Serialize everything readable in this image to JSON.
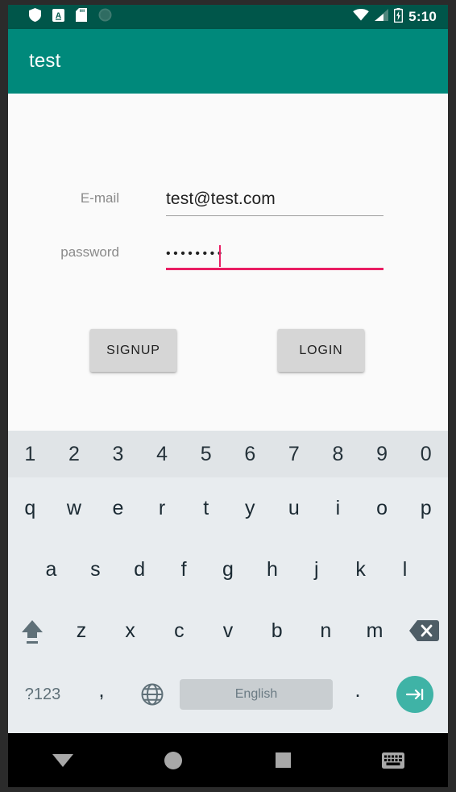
{
  "status_bar": {
    "icons": [
      "shield-icon",
      "a-badge-icon",
      "sd-card-icon",
      "sync-circle-icon"
    ],
    "wifi": "wifi-icon",
    "signal": "signal-icon",
    "battery": "battery-charging-icon",
    "clock": "5:10"
  },
  "app_bar": {
    "title": "test",
    "color": "#00897b"
  },
  "form": {
    "email": {
      "label": "E-mail",
      "value": "test@test.com",
      "underline_color": "#9e9e9e",
      "focused": false
    },
    "password": {
      "label": "password",
      "value": "••••••••",
      "underline_color": "#e91e63",
      "focused": true
    },
    "signup_label": "SIGNUP",
    "login_label": "LOGIN"
  },
  "keyboard": {
    "number_row": [
      "1",
      "2",
      "3",
      "4",
      "5",
      "6",
      "7",
      "8",
      "9",
      "0"
    ],
    "row1": [
      "q",
      "w",
      "e",
      "r",
      "t",
      "y",
      "u",
      "i",
      "o",
      "p"
    ],
    "row2": [
      "a",
      "s",
      "d",
      "f",
      "g",
      "h",
      "j",
      "k",
      "l"
    ],
    "row3": [
      "z",
      "x",
      "c",
      "v",
      "b",
      "n",
      "m"
    ],
    "shift": "shift-icon",
    "backspace": "backspace-icon",
    "symbols_label": "?123",
    "comma_label": ",",
    "globe": "globe-icon",
    "space_label": "English",
    "period_label": ".",
    "enter": "next-arrow-icon",
    "enter_color": "#3fb3a6"
  },
  "nav_bar": {
    "back": "triangle-down-icon",
    "home": "circle-icon",
    "recents": "square-icon",
    "keyboard_toggle": "keyboard-icon"
  }
}
